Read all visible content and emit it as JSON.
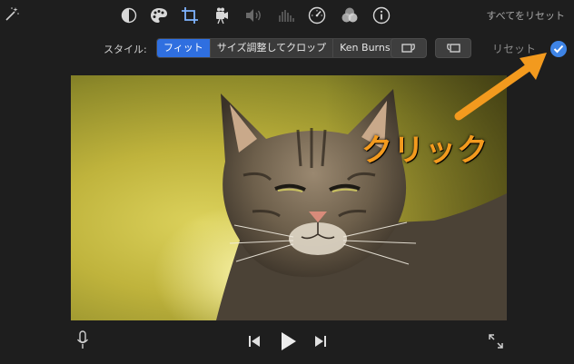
{
  "toolbar": {
    "reset_all_label": "すべてをリセット",
    "icons": [
      "magic-wand-icon",
      "color-balance-icon",
      "color-palette-icon",
      "crop-icon",
      "stabilization-icon",
      "volume-icon",
      "equalizer-icon",
      "speed-icon",
      "filters-icon",
      "info-icon"
    ]
  },
  "style_row": {
    "label": "スタイル:",
    "options": [
      "フィット",
      "サイズ調整してクロップ",
      "Ken Burns"
    ],
    "selected": "フィット",
    "reset_label": "リセット"
  },
  "annotation": {
    "text": "クリック",
    "color": "#f39a1e"
  },
  "colors": {
    "accent": "#2f6fe0",
    "check": "#3e84e6",
    "arrow": "#f39a1e",
    "background": "#1e1e1e"
  }
}
